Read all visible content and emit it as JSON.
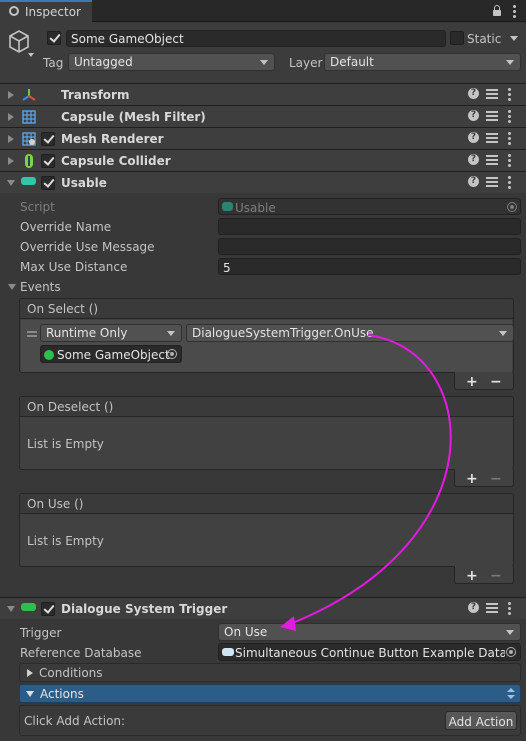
{
  "tab": {
    "title": "Inspector"
  },
  "header": {
    "object_name": "Some GameObject",
    "static_label": "Static",
    "tag_label": "Tag",
    "tag_value": "Untagged",
    "layer_label": "Layer",
    "layer_value": "Default"
  },
  "components": {
    "transform": "Transform",
    "mesh_filter": "Capsule (Mesh Filter)",
    "mesh_renderer": "Mesh Renderer",
    "capsule_collider": "Capsule Collider",
    "usable": "Usable",
    "dialogue_trigger": "Dialogue System Trigger"
  },
  "usable": {
    "script_label": "Script",
    "script_value": "Usable",
    "override_name_label": "Override Name",
    "override_name_value": "",
    "override_use_label": "Override Use Message",
    "override_use_value": "",
    "max_distance_label": "Max Use Distance",
    "max_distance_value": "5",
    "events_label": "Events"
  },
  "events": {
    "on_select": "On Select ()",
    "runtime_value": "Runtime Only",
    "function_value": "DialogueSystemTrigger.OnUse",
    "target_object": "Some GameObject",
    "on_deselect": "On Deselect ()",
    "on_use": "On Use ()",
    "empty_text": "List is Empty",
    "plus": "+",
    "minus": "−"
  },
  "trigger": {
    "trigger_label": "Trigger",
    "trigger_value": "On Use",
    "db_label": "Reference Database",
    "db_value": "Simultaneous Continue Button Example Databas",
    "conditions_label": "Conditions",
    "actions_label": "Actions",
    "click_add_label": "Click Add Action:",
    "add_action_button": "Add Action"
  },
  "colors": {
    "background": "#383838",
    "arrow": "#e41ae0",
    "actions_bar": "#2c5d87",
    "green_icon": "#2bbf4e",
    "teal_icon": "#2ec7a7"
  },
  "icons": {
    "tab": "inspector-icon",
    "lock": "lock-icon",
    "cube": "cube-icon",
    "transform": "transform-axes-icon",
    "mesh_filter": "mesh-grid-icon",
    "mesh_renderer": "mesh-renderer-icon",
    "collider": "capsule-collider-icon",
    "usable": "usable-script-icon",
    "trigger": "dialogue-trigger-icon"
  }
}
